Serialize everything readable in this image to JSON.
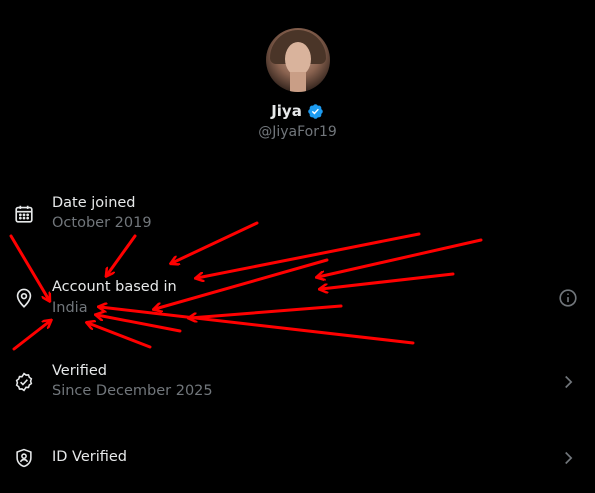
{
  "profile": {
    "name": "Jiya",
    "handle": "@JiyaFor19"
  },
  "rows": [
    {
      "title": "Date joined",
      "subtitle": "October 2019",
      "icon": "calendar-icon"
    },
    {
      "title": "Account based in",
      "subtitle": "India",
      "icon": "location-pin-icon",
      "trailing_icon": "info-icon"
    },
    {
      "title": "Verified",
      "subtitle": "Since December 2025",
      "icon": "verified-check-icon",
      "trailing_icon": "chevron-right-icon"
    },
    {
      "title": "ID Verified",
      "icon": "id-shield-icon",
      "trailing_icon": "chevron-right-icon"
    }
  ],
  "colors": {
    "background": "#000000",
    "primary_text": "#e7e9ea",
    "secondary_text": "#71767b",
    "verified_blue": "#1d9bf0",
    "annotation_red": "#ff0000"
  }
}
